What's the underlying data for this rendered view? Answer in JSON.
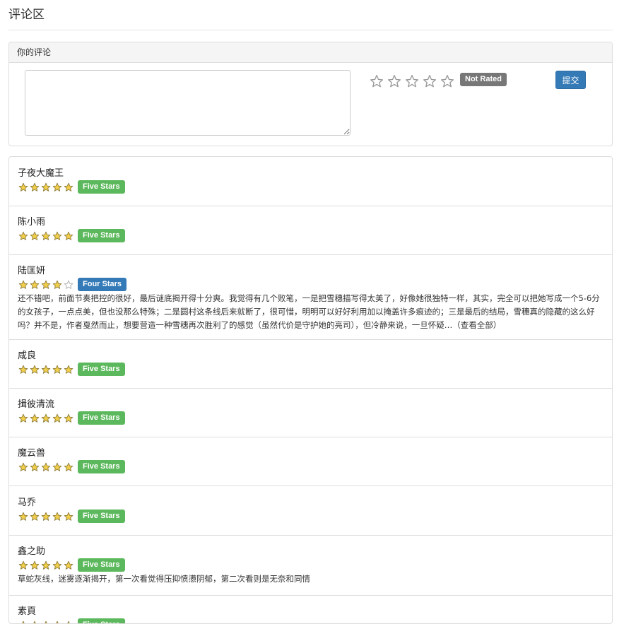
{
  "page": {
    "title": "评论区"
  },
  "compose": {
    "heading": "你的评论",
    "textarea_placeholder": "",
    "rating_label": "Not Rated",
    "submit_label": "提交"
  },
  "colors": {
    "primary": "#337ab7",
    "success": "#5cb85c",
    "default": "#777777",
    "star_fill": "#f2cf4a"
  },
  "comments": [
    {
      "author": "子夜大魔王",
      "stars": 5,
      "label": "Five Stars",
      "text": ""
    },
    {
      "author": "陈小雨",
      "stars": 5,
      "label": "Five Stars",
      "text": ""
    },
    {
      "author": "陆匡妍",
      "stars": 4,
      "label": "Four Stars",
      "text": "还不错吧，前面节奏把控的很好，最后谜底揭开得十分爽。我觉得有几个败笔，一是把雪穗描写得太美了，好像她很独特一样，其实，完全可以把她写成一个5-6分的女孩子，一点点美，但也没那么特殊；二是圆村这条线后来就断了，很可惜，明明可以好好利用加以掩盖许多痕迹的；三是最后的结局，雪穗真的隐藏的这么好吗？并不是，作者戛然而止，想要营造一种雪穗再次胜利了的感觉（虽然代价是守护她的亮司），但冷静来说，一旦怀疑…",
      "more": "（查看全部）"
    },
    {
      "author": "咸良",
      "stars": 5,
      "label": "Five Stars",
      "text": ""
    },
    {
      "author": "揖彼清流",
      "stars": 5,
      "label": "Five Stars",
      "text": ""
    },
    {
      "author": "魔云兽",
      "stars": 5,
      "label": "Five Stars",
      "text": ""
    },
    {
      "author": "马乔",
      "stars": 5,
      "label": "Five Stars",
      "text": ""
    },
    {
      "author": "鑫之助",
      "stars": 5,
      "label": "Five Stars",
      "text": "草蛇灰线，迷雾逐渐揭开，第一次看觉得压抑愤懑阴郁，第二次看则是无奈和同情"
    },
    {
      "author": "素頁",
      "stars": 5,
      "label": "Five Stars",
      "text": ""
    }
  ]
}
